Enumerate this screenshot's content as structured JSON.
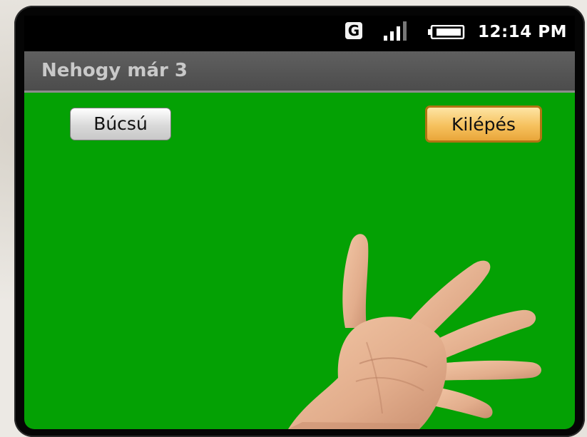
{
  "status_bar": {
    "network_label": "G",
    "signal_icon": "signal-bars-icon",
    "battery_icon": "battery-icon",
    "time": "12:14 PM"
  },
  "app": {
    "title": "Nehogy már 3"
  },
  "buttons": {
    "bucsu_label": "Búcsú",
    "kilepes_label": "Kilépés"
  },
  "content": {
    "background_color": "#04a104",
    "image": "open-hand-five-fingers"
  }
}
